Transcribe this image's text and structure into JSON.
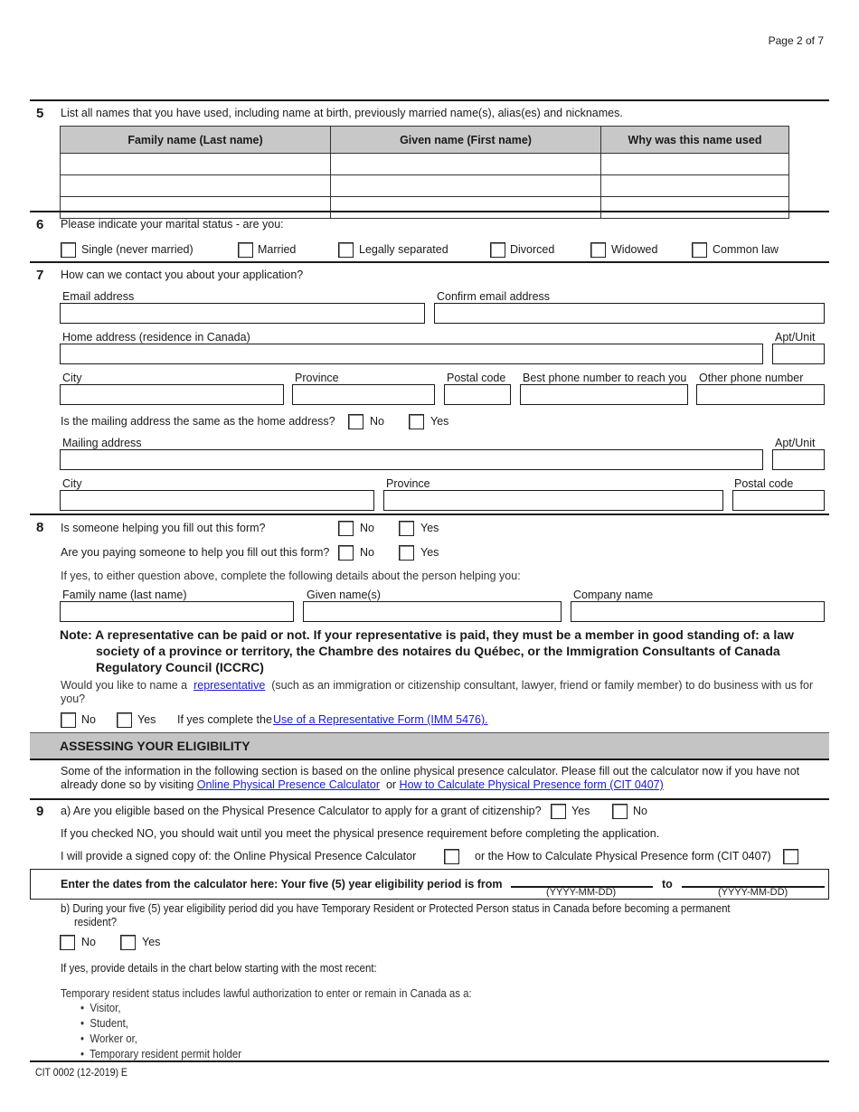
{
  "header": {
    "page_indicator": "Page 2 of 7"
  },
  "q5": {
    "number": "5",
    "question": "List all names that you have used, including name at birth, previously married name(s), alias(es) and nicknames.",
    "columns": [
      "Family name (Last name)",
      "Given name (First name)",
      "Why was this name used"
    ],
    "rows": [
      [
        "",
        "",
        ""
      ],
      [
        "",
        "",
        ""
      ],
      [
        "",
        "",
        ""
      ]
    ]
  },
  "q6": {
    "number": "6",
    "question": "Please indicate your marital status - are you:",
    "options": [
      "Single (never married)",
      "Married",
      "Legally separated",
      "Divorced",
      "Widowed",
      "Common law"
    ]
  },
  "q7": {
    "number": "7",
    "question": "How can we contact you about your application?",
    "email_label": "Email address",
    "email_value": "",
    "confirm_email_label": "Confirm email address",
    "confirm_email_value": "",
    "home_address_label": "Home address (residence in Canada)",
    "home_apt_label": "Apt/Unit",
    "city_label": "City",
    "province_label": "Province",
    "postal_label": "Postal code",
    "best_phone_label": "Best phone number to reach you",
    "other_phone_label": "Other phone number",
    "mailing_same_question": "Is the mailing address the same as the home address?",
    "no_label": "No",
    "yes_label": "Yes",
    "mailing_address_label": "Mailing address",
    "mailing_apt_label": "Apt/Unit",
    "mailing_city_label": "City",
    "mailing_province_label": "Province",
    "mailing_postal_label": "Postal code"
  },
  "q8": {
    "number": "8",
    "helping_question": "Is someone helping you fill out this form?",
    "paying_question": "Are you paying someone to help you fill out this form?",
    "no_label": "No",
    "yes_label": "Yes",
    "details_instruction": "If yes, to either question above, complete the following details about the person helping you:",
    "family_name_label": "Family name (last name)",
    "given_name_label": "Given name(s)",
    "company_label": "Company name",
    "note_line1": "Note: A representative can be paid or not.  If your representative is paid, they must be a member in good standing of:  a law",
    "note_line2": "society of a province or territory, the Chambre des notaires du Québec, or the Immigration Consultants of Canada",
    "note_line3": "Regulatory Council (ICCRC)",
    "rep_question_pre": "Would you like to name a",
    "rep_link": "representative",
    "rep_question_post": "(such as an immigration or citizenship consultant, lawyer, friend or family member) to do business with us for",
    "rep_question_end": "you?",
    "if_yes_text": "If yes complete the",
    "rep_form_link": "Use of a Representative Form (IMM 5476)."
  },
  "eligibility": {
    "section_title": "ASSESSING YOUR ELIGIBILITY",
    "intro_line1": "Some of the information in the following section is based on the online physical presence calculator. Please fill out the calculator now if you have not",
    "intro_line2_pre": "already done so by visiting",
    "calculator_link": "Online Physical Presence Calculator",
    "or_text": "or",
    "cit0407_link": "How to Calculate Physical Presence form (CIT 0407)"
  },
  "q9": {
    "number": "9",
    "a_question": "a) Are you eligible based on the Physical Presence Calculator to apply for a grant of citizenship?",
    "yes_label": "Yes",
    "no_label": "No",
    "no_instruction": "If you checked NO, you should wait until you meet the physical presence requirement before completing the application.",
    "signed_copy_text": "I will provide a signed copy of: the Online Physical Presence Calculator",
    "or_cit_text": "or the How to Calculate Physical Presence form (CIT 0407)",
    "dates_text": "Enter the dates from the calculator here:  Your five (5) year eligibility period is from",
    "to_text": "to",
    "date_format_hint": "(YYYY-MM-DD)",
    "from_date_value": "",
    "to_date_value": "",
    "b_question_line1": "b) During your five (5) year eligibility period did you have Temporary Resident or Protected Person status in Canada before becoming a permanent",
    "b_question_line2": "resident?",
    "b_no_label": "No",
    "b_yes_label": "Yes",
    "details_instruction": "If yes, provide details in the chart below starting with the most recent:",
    "temp_status_intro": "Temporary resident status includes lawful authorization to enter or remain in Canada as a:",
    "temp_status_list": [
      "Visitor,",
      "Student,",
      "Worker or,",
      "Temporary resident permit holder"
    ]
  },
  "footer": {
    "form_code": "CIT 0002 (12-2019) E"
  }
}
